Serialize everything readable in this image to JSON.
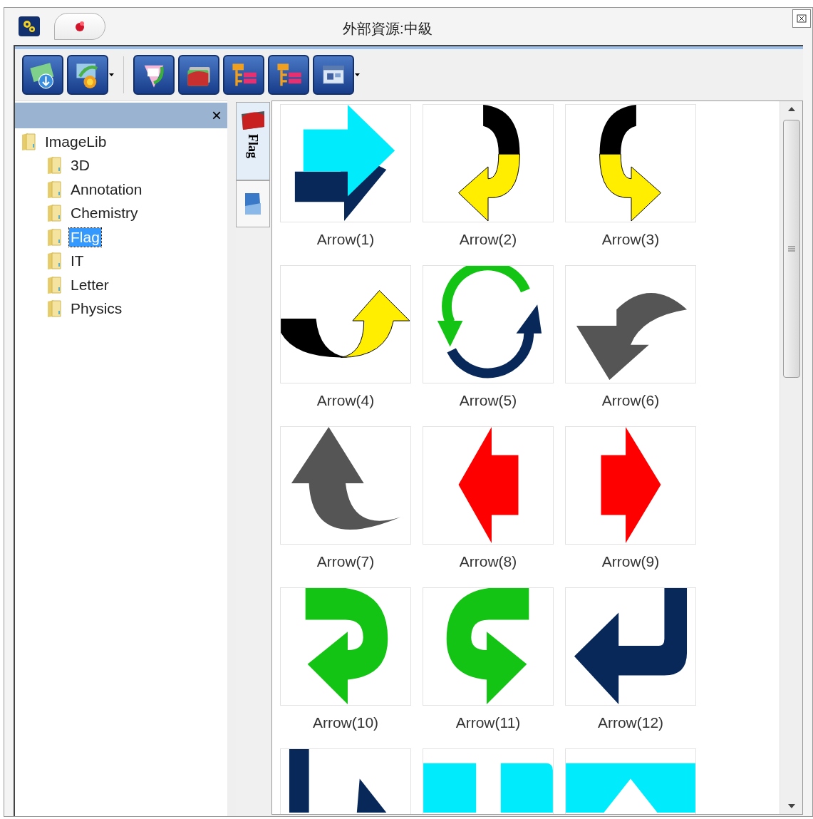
{
  "window": {
    "title": "外部資源:中級"
  },
  "toolbar": [
    {
      "kind": "download",
      "dropdown": false
    },
    {
      "kind": "sun",
      "dropdown": true
    },
    {
      "kind": "document",
      "dropdown": false
    },
    {
      "kind": "folders",
      "dropdown": false
    },
    {
      "kind": "list",
      "dropdown": false
    },
    {
      "kind": "list",
      "dropdown": false
    },
    {
      "kind": "window",
      "dropdown": true
    }
  ],
  "panel": {
    "close": "×"
  },
  "tree": [
    {
      "label": "ImageLib",
      "selected": false,
      "children": [
        {
          "label": "3D",
          "selected": false
        },
        {
          "label": "Annotation",
          "selected": false
        },
        {
          "label": "Chemistry",
          "selected": false
        },
        {
          "label": "Flag",
          "selected": true
        },
        {
          "label": "IT",
          "selected": false
        },
        {
          "label": "Letter",
          "selected": false
        },
        {
          "label": "Physics",
          "selected": false
        }
      ]
    }
  ],
  "side_tabs": [
    {
      "kind": "folder",
      "label": "Flag",
      "selected": true
    },
    {
      "kind": "picture",
      "selected": false
    }
  ],
  "gallery": [
    {
      "kind": "double",
      "label": "Arrow(1)"
    },
    {
      "kind": "curlleft",
      "label": "Arrow(2)"
    },
    {
      "kind": "curlright",
      "label": "Arrow(3)"
    },
    {
      "kind": "swoop",
      "label": "Arrow(4)"
    },
    {
      "kind": "cycle",
      "label": "Arrow(5)"
    },
    {
      "kind": "curvedown",
      "label": "Arrow(6)"
    },
    {
      "kind": "curveup",
      "label": "Arrow(7)"
    },
    {
      "kind": "left",
      "label": "Arrow(8)"
    },
    {
      "kind": "right",
      "label": "Arrow(9)"
    },
    {
      "kind": "hookleft",
      "label": "Arrow(10)"
    },
    {
      "kind": "hookright",
      "label": "Arrow(11)"
    },
    {
      "kind": "return",
      "label": "Arrow(12)"
    },
    {
      "kind": "partnavy"
    },
    {
      "kind": "partblocks"
    },
    {
      "kind": "parttriangle"
    }
  ]
}
